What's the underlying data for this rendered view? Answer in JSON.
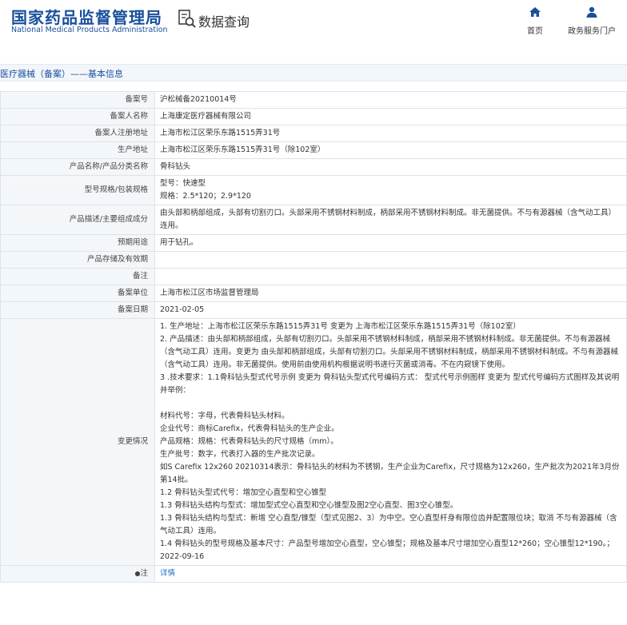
{
  "header": {
    "logo_cn": "国家药品监督管理局",
    "logo_en": "National Medical Products Administration",
    "query_title": "数据查询",
    "nav": {
      "home": "首页",
      "services": "政务服务门户"
    }
  },
  "breadcrumb": "医疗器械（备案）——基本信息",
  "rows": [
    {
      "label": "备案号",
      "value": "沪松械备20210014号"
    },
    {
      "label": "备案人名称",
      "value": "上海康定医疗器械有限公司"
    },
    {
      "label": "备案人注册地址",
      "value": "上海市松江区荣乐东路1515弄31号"
    },
    {
      "label": "生产地址",
      "value": "上海市松江区荣乐东路1515弄31号（除102室）"
    },
    {
      "label": "产品名称/产品分类名称",
      "value": "骨科钻头"
    },
    {
      "label": "型号规格/包装规格",
      "value": "型号：快速型\n规格：2.5*120；2.9*120"
    },
    {
      "label": "产品描述/主要组成成分",
      "value": "由头部和柄部组成，头部有切割刃口。头部采用不锈钢材料制成，柄部采用不锈钢材料制成。非无菌提供。不与有源器械（含气动工具）连用。"
    },
    {
      "label": "预期用途",
      "value": "用于钻孔。"
    },
    {
      "label": "产品存储及有效期",
      "value": ""
    },
    {
      "label": "备注",
      "value": ""
    },
    {
      "label": "备案单位",
      "value": "上海市松江区市场监督管理局"
    },
    {
      "label": "备案日期",
      "value": "2021-02-05"
    },
    {
      "label": "变更情况",
      "value": "1. 生产地址：上海市松江区荣乐东路1515弄31号 变更为 上海市松江区荣乐东路1515弄31号（除102室）\n2. 产品描述：由头部和柄部组成，头部有切割刃口。头部采用不锈钢材料制成，柄部采用不锈钢材料制成。非无菌提供。不与有源器械（含气动工具）连用。变更为 由头部和柄部组成，头部有切割刃口。头部采用不锈钢材料制成，柄部采用不锈钢材料制成。不与有源器械（含气动工具）连用。非无菌提供。使用前由使用机构根据说明书进行灭菌或消毒。不在内窥镜下使用。\n3 .技术要求：1.1骨科钻头型式代号示例 变更为 骨科钻头型式代号编码方式： 型式代号示例图样 变更为 型式代号编码方式图样及其说明并举例：\n\n材料代号：字母，代表骨科钻头材料。\n企业代号：商标Carefix，代表骨科钻头的生产企业。\n产品规格：规格：代表骨科钻头的尺寸规格（mm）。\n生产批号：数字，代表打入器的生产批次记录。\n如S Carefix 12x260 20210314表示：骨科钻头的材料为不锈钢，生产企业为Carefix，尺寸规格为12x260，生产批次为2021年3月份第14批。\n1.2 骨科钻头型式代号：增加空心直型和空心锥型\n1.3 骨科钻头结构与型式：增加型式空心直型和空心锥型及图2空心直型、图3空心锥型。\n1.3 骨科钻头结构与型式：新增 空心直型/锥型（型式见图2、3）为中空。空心直型杆身有限位齿并配置限位块；取消 不与有源器械（含气动工具）连用。\n1.4 骨科钻头的型号规格及基本尺寸：产品型号增加空心直型，空心锥型；规格及基本尺寸增加空心直型12*260；空心锥型12*190。；\n2022-09-16"
    }
  ],
  "last_row": {
    "label": "注",
    "link": "详情"
  }
}
